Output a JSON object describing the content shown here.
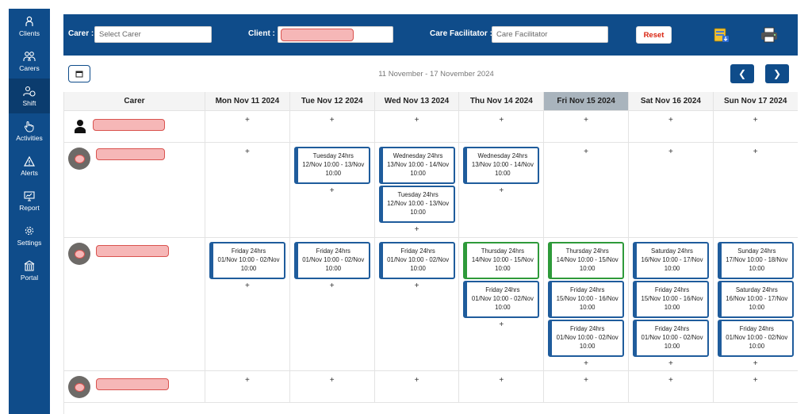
{
  "sidebar": {
    "items": [
      {
        "label": "Clients",
        "icon": "person-icon"
      },
      {
        "label": "Carers",
        "icon": "people-icon"
      },
      {
        "label": "Shift",
        "icon": "shift-icon",
        "active": true
      },
      {
        "label": "Activities",
        "icon": "hand-icon"
      },
      {
        "label": "Alerts",
        "icon": "warning-icon"
      },
      {
        "label": "Report",
        "icon": "monitor-icon"
      },
      {
        "label": "Settings",
        "icon": "gear-icon"
      },
      {
        "label": "Portal",
        "icon": "building-icon"
      }
    ]
  },
  "filters": {
    "carer_label": "Carer :",
    "carer_placeholder": "Select Carer",
    "client_label": "Client :",
    "facilitator_label": "Care Facilitator :",
    "facilitator_placeholder": "Care Facilitator",
    "reset_label": "Reset"
  },
  "toolbar": {
    "export_icon": "export-icon",
    "print_icon": "printer-icon"
  },
  "week": {
    "range": "11 November - 17 November 2024"
  },
  "grid": {
    "carer_header": "Carer",
    "days": [
      "Mon Nov 11 2024",
      "Tue Nov 12 2024",
      "Wed Nov 13 2024",
      "Thu Nov 14 2024",
      "Fri Nov 15 2024",
      "Sat Nov 16 2024",
      "Sun Nov 17 2024"
    ],
    "today_index": 4,
    "add_symbol": "+",
    "rows": [
      {
        "carer": "redacted",
        "shifts": [
          [],
          [],
          [],
          [],
          [],
          [],
          []
        ]
      },
      {
        "carer": "redacted",
        "shifts": [
          [],
          [
            {
              "title": "Tuesday 24hrs",
              "range": "12/Nov 10:00 - 13/Nov",
              "end": "10:00",
              "color": "blue"
            }
          ],
          [
            {
              "title": "Wednesday 24hrs",
              "range": "13/Nov 10:00 - 14/Nov",
              "end": "10:00",
              "color": "blue"
            },
            {
              "title": "Tuesday 24hrs",
              "range": "12/Nov 10:00 - 13/Nov",
              "end": "10:00",
              "color": "blue"
            }
          ],
          [
            {
              "title": "Wednesday 24hrs",
              "range": "13/Nov 10:00 - 14/Nov",
              "end": "10:00",
              "color": "blue"
            }
          ],
          [],
          [],
          []
        ]
      },
      {
        "carer": "redacted",
        "shifts": [
          [
            {
              "title": "Friday 24hrs",
              "range": "01/Nov 10:00 - 02/Nov",
              "end": "10:00",
              "color": "blue"
            }
          ],
          [
            {
              "title": "Friday 24hrs",
              "range": "01/Nov 10:00 - 02/Nov",
              "end": "10:00",
              "color": "blue"
            }
          ],
          [
            {
              "title": "Friday 24hrs",
              "range": "01/Nov 10:00 - 02/Nov",
              "end": "10:00",
              "color": "blue"
            }
          ],
          [
            {
              "title": "Thursday 24hrs",
              "range": "14/Nov 10:00 - 15/Nov",
              "end": "10:00",
              "color": "green"
            },
            {
              "title": "Friday 24hrs",
              "range": "01/Nov 10:00 - 02/Nov",
              "end": "10:00",
              "color": "blue"
            }
          ],
          [
            {
              "title": "Thursday 24hrs",
              "range": "14/Nov 10:00 - 15/Nov",
              "end": "10:00",
              "color": "green"
            },
            {
              "title": "Friday 24hrs",
              "range": "15/Nov 10:00 - 16/Nov",
              "end": "10:00",
              "color": "blue"
            },
            {
              "title": "Friday 24hrs",
              "range": "01/Nov 10:00 - 02/Nov",
              "end": "10:00",
              "color": "blue"
            }
          ],
          [
            {
              "title": "Saturday 24hrs",
              "range": "16/Nov 10:00 - 17/Nov",
              "end": "10:00",
              "color": "blue"
            },
            {
              "title": "Friday 24hrs",
              "range": "15/Nov 10:00 - 16/Nov",
              "end": "10:00",
              "color": "blue"
            },
            {
              "title": "Friday 24hrs",
              "range": "01/Nov 10:00 - 02/Nov",
              "end": "10:00",
              "color": "blue"
            }
          ],
          [
            {
              "title": "Sunday 24hrs",
              "range": "17/Nov 10:00 - 18/Nov",
              "end": "10:00",
              "color": "blue"
            },
            {
              "title": "Saturday 24hrs",
              "range": "16/Nov 10:00 - 17/Nov",
              "end": "10:00",
              "color": "blue"
            },
            {
              "title": "Friday 24hrs",
              "range": "01/Nov 10:00 - 02/Nov",
              "end": "10:00",
              "color": "blue"
            }
          ]
        ]
      },
      {
        "carer": "redacted",
        "shifts": [
          [],
          [],
          [],
          [],
          [],
          [],
          []
        ]
      }
    ]
  },
  "colors": {
    "primary": "#0f4c8a",
    "shift_blue": "#1f5c9c",
    "shift_green": "#2e9a3a",
    "today_header": "#a9b4bd",
    "reset_text": "#d9230f",
    "redaction": "#f6b7b7"
  }
}
